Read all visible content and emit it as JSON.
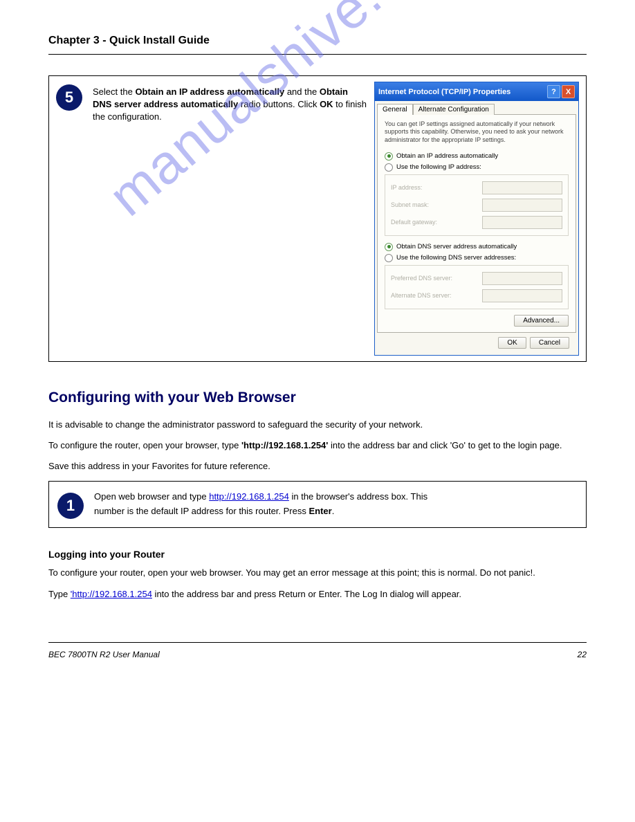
{
  "header": "Chapter 3 - Quick Install Guide",
  "watermark": "manualshive.com",
  "step5": {
    "badge": "5",
    "text_before": "Select the ",
    "bold1": "Obtain an IP address automatically",
    "mid1": " and the ",
    "bold2": "Obtain DNS server address automatically",
    "mid2": " radio buttons. Click ",
    "bold3": "OK",
    "after": " to finish the configuration."
  },
  "dialog": {
    "title": "Internet Protocol (TCP/IP) Properties",
    "help": "?",
    "close": "X",
    "tabs": {
      "general": "General",
      "alt": "Alternate Configuration"
    },
    "desc": "You can get IP settings assigned automatically if your network supports this capability. Otherwise, you need to ask your network administrator for the appropriate IP settings.",
    "r1": "Obtain an IP address automatically",
    "r2": "Use the following IP address:",
    "f_ip": "IP address:",
    "f_mask": "Subnet mask:",
    "f_gw": "Default gateway:",
    "r3": "Obtain DNS server address automatically",
    "r4": "Use the following DNS server addresses:",
    "f_pdns": "Preferred DNS server:",
    "f_adns": "Alternate DNS server:",
    "advanced": "Advanced...",
    "ok": "OK",
    "cancel": "Cancel"
  },
  "cfg": {
    "title": "Configuring with your Web Browser",
    "p1": "It is advisable to change the administrator password to safeguard the security of your network.",
    "p2_before": "To configure the router, open your browser, type ",
    "p2_url": "'http://192.168.1.254'",
    "p2_after": " into the address bar and click 'Go' to get to the login page.",
    "p3": "Save this address in your Favorites for future reference."
  },
  "step1": {
    "badge": "1",
    "l1_a": "Open web browser and type ",
    "l1_url": "http://192.168.1.254",
    "l1_b": " in the browser's address box. This",
    "l2": "number is the default IP address for this router. Press ",
    "l2_bold": "Enter",
    "l2_end": "."
  },
  "login": {
    "h": "Logging into your Router",
    "p1": "To configure your router, open your web browser. You may get an error message at this point; this is normal. Do not panic!.",
    "p2_before": "Type ",
    "p2_url": "'http://192.168.1.254",
    "p2_after": " into the address bar and press Return or Enter. The Log In dialog will appear."
  },
  "footer": {
    "left": "BEC 7800TN R2 User Manual",
    "right": "22"
  }
}
